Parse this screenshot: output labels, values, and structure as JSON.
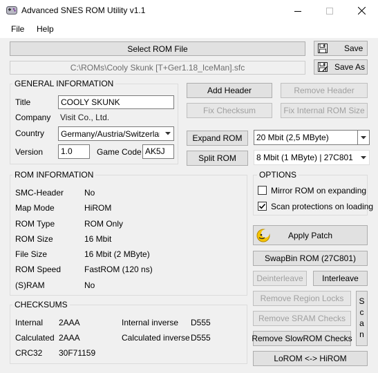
{
  "window": {
    "title": "Advanced SNES ROM Utility v1.1"
  },
  "menu": {
    "file": "File",
    "help": "Help"
  },
  "top": {
    "select_rom": "Select ROM File",
    "file_path": "C:\\ROMs\\Cooly Skunk [T+Ger1.18_IceMan].sfc",
    "save": "Save",
    "save_as": "Save As"
  },
  "general": {
    "title": "GENERAL INFORMATION",
    "title_label": "Title",
    "title_value": "COOLY SKUNK",
    "company_label": "Company",
    "company_value": "Visit Co., Ltd.",
    "country_label": "Country",
    "country_value": "Germany/Austria/Switzerland (P",
    "version_label": "Version",
    "version_value": "1.0",
    "game_code_label": "Game Code",
    "game_code_value": "AK5J"
  },
  "header_buttons": {
    "add_header": "Add Header",
    "remove_header": "Remove Header",
    "fix_checksum": "Fix Checksum",
    "fix_internal_size": "Fix Internal ROM Size"
  },
  "expand": {
    "expand_rom": "Expand ROM",
    "expand_size": "20 Mbit (2,5 MByte)",
    "split_rom": "Split ROM",
    "split_size": "8 Mbit (1 MByte) | 27C801"
  },
  "rom_info": {
    "title": "ROM INFORMATION",
    "rows": [
      {
        "label": "SMC-Header",
        "value": "No"
      },
      {
        "label": "Map Mode",
        "value": "HiROM"
      },
      {
        "label": "ROM Type",
        "value": "ROM Only"
      },
      {
        "label": "ROM Size",
        "value": "16 Mbit"
      },
      {
        "label": "File Size",
        "value": "16 Mbit (2 MByte)"
      },
      {
        "label": "ROM Speed",
        "value": "FastROM (120 ns)"
      },
      {
        "label": "(S)RAM",
        "value": "No"
      }
    ]
  },
  "options": {
    "title": "OPTIONS",
    "mirror": "Mirror ROM on expanding",
    "mirror_checked": false,
    "scan": "Scan protections on loading",
    "scan_checked": true
  },
  "actions": {
    "apply_patch": "Apply Patch",
    "swapbin": "SwapBin ROM (27C801)",
    "deinterleave": "Deinterleave",
    "interleave": "Interleave",
    "remove_region": "Remove Region Locks",
    "remove_sram": "Remove SRAM Checks",
    "remove_slowrom": "Remove SlowROM Checks",
    "scan": "Scan",
    "lorom_hirom": "LoROM <-> HiROM"
  },
  "checksums": {
    "title": "CHECKSUMS",
    "internal_label": "Internal",
    "internal_value": "2AAA",
    "internal_inverse_label": "Internal inverse",
    "internal_inverse_value": "D555",
    "calculated_label": "Calculated",
    "calculated_value": "2AAA",
    "calculated_inverse_label": "Calculated inverse",
    "calculated_inverse_value": "D555",
    "crc32_label": "CRC32",
    "crc32_value": "30F71159"
  }
}
